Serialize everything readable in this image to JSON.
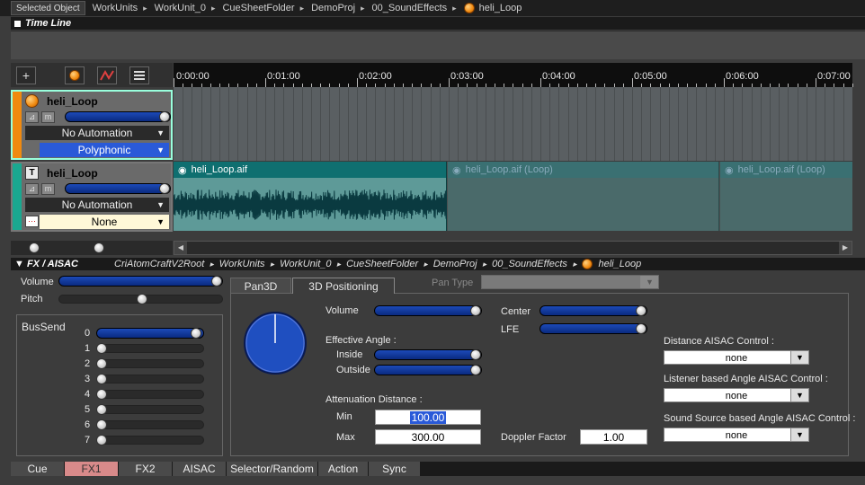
{
  "topbar": {
    "selected_label": "Selected Object",
    "crumbs": [
      "WorkUnits",
      "WorkUnit_0",
      "CueSheetFolder",
      "DemoProj",
      "00_SoundEffects",
      "heli_Loop"
    ]
  },
  "timeline": {
    "title": "Time Line",
    "ruler": [
      "0:00:00",
      "0:01:00",
      "0:02:00",
      "0:03:00",
      "0:04:00",
      "0:05:00",
      "0:06:00",
      "0:07:00"
    ]
  },
  "tracks": [
    {
      "name": "heli_Loop",
      "automation": "No Automation",
      "mode": "Polyphonic",
      "volume": 0.95
    },
    {
      "name": "heli_Loop",
      "automation": "No Automation",
      "mode": "None",
      "volume": 0.95
    }
  ],
  "clips": [
    {
      "label": "heli_Loop.aif"
    },
    {
      "label": "heli_Loop.aif (Loop)"
    },
    {
      "label": "heli_Loop.aif (Loop)"
    }
  ],
  "fx": {
    "title": "FX / AISAC",
    "crumbs": [
      "CriAtomCraftV2Root",
      "WorkUnits",
      "WorkUnit_0",
      "CueSheetFolder",
      "DemoProj",
      "00_SoundEffects",
      "heli_Loop"
    ],
    "volume_label": "Volume",
    "pitch_label": "Pitch",
    "volume_level": 0.98,
    "pitch_level": 0.5,
    "bussend_title": "BusSend",
    "buses": [
      "0",
      "1",
      "2",
      "3",
      "4",
      "5",
      "6",
      "7"
    ],
    "bus_levels": [
      0.98,
      0,
      0,
      0,
      0,
      0,
      0,
      0
    ]
  },
  "positioning": {
    "tab1": "Pan3D",
    "tab2": "3D Positioning",
    "pan_type_label": "Pan Type",
    "volume_label": "Volume",
    "effective_angle_label": "Effective Angle :",
    "inside_label": "Inside",
    "outside_label": "Outside",
    "attenuation_label": "Attenuation Distance :",
    "min_label": "Min",
    "max_label": "Max",
    "min_value": "100.00",
    "max_value": "300.00",
    "center_label": "Center",
    "lfe_label": "LFE",
    "doppler_label": "Doppler Factor",
    "doppler_value": "1.00",
    "distance_aisac_label": "Distance AISAC Control :",
    "listener_aisac_label": "Listener based Angle AISAC Control :",
    "source_aisac_label": "Sound Source based Angle AISAC Control :",
    "distance_aisac_value": "none",
    "listener_aisac_value": "none",
    "source_aisac_value": "none"
  },
  "bottom_tabs": [
    "Cue",
    "FX1",
    "FX2",
    "AISAC",
    "Selector/Random",
    "Action",
    "Sync"
  ],
  "colors": {
    "accent_blue": "#1c4ab8",
    "track1_strip": "#f08a10",
    "track2_strip": "#1aa890",
    "clip_teal": "#1a8a8a"
  }
}
